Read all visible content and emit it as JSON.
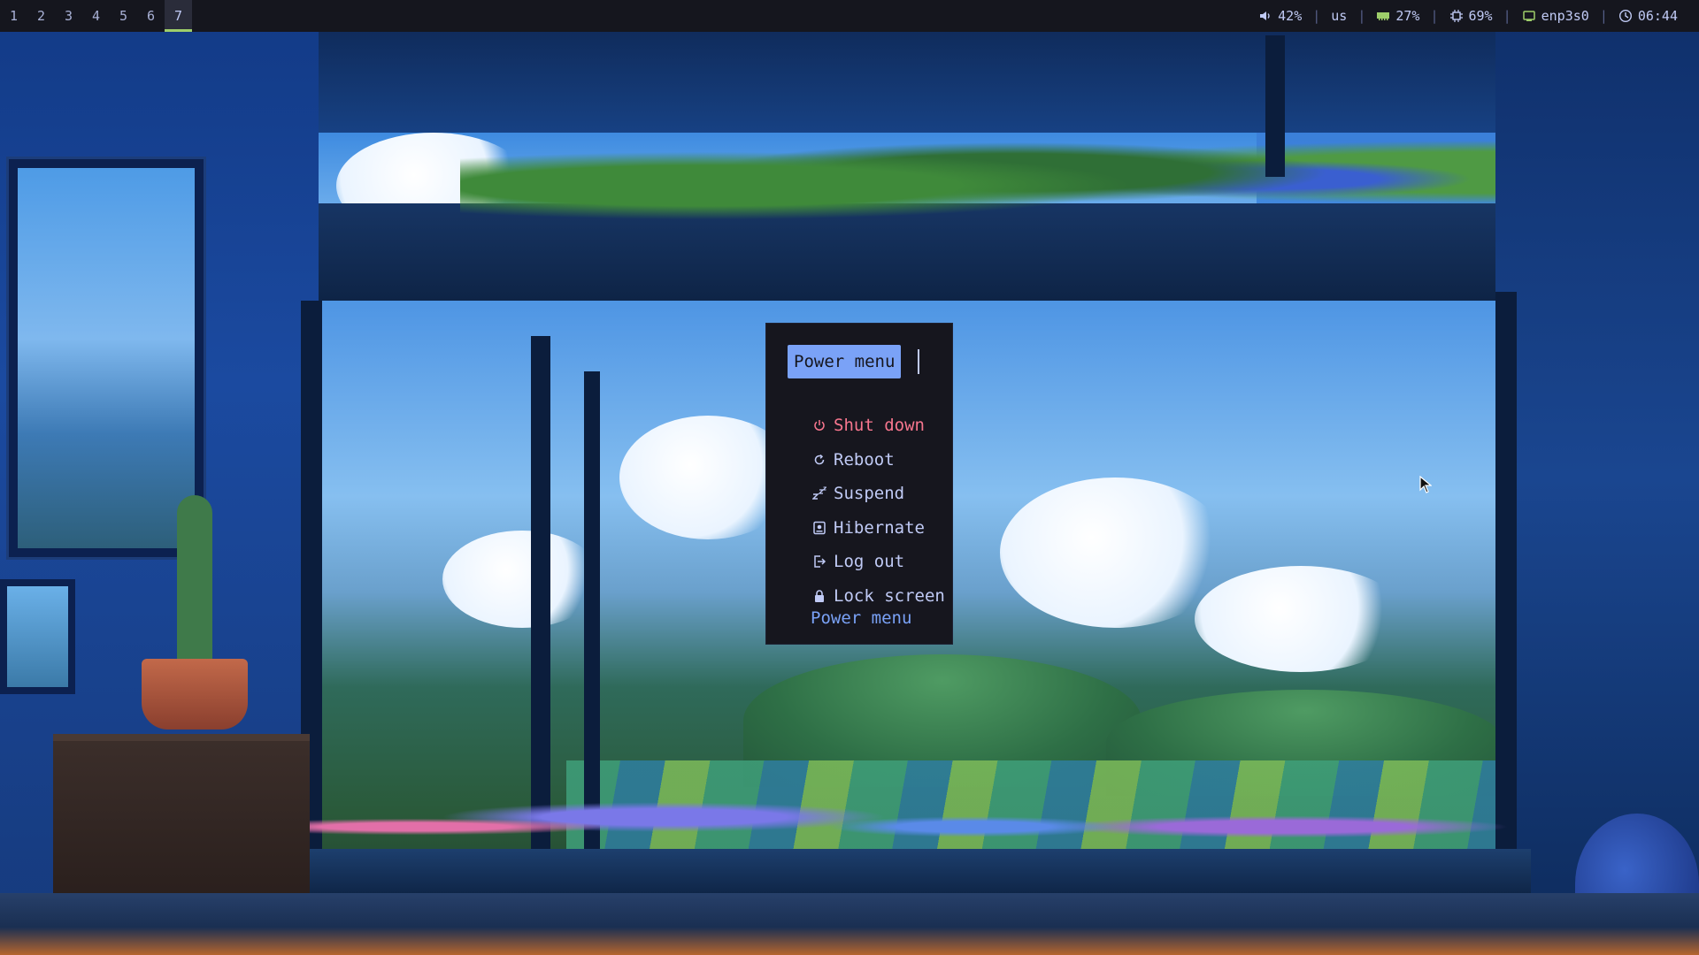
{
  "topbar": {
    "workspaces": [
      "1",
      "2",
      "3",
      "4",
      "5",
      "6",
      "7"
    ],
    "active_workspace": "7",
    "volume": {
      "icon": "volume-icon",
      "label": "42%"
    },
    "keyboard_layout": "us",
    "memory": {
      "icon": "memory-icon",
      "label": "27%"
    },
    "cpu": {
      "icon": "cpu-icon",
      "label": "69%"
    },
    "network": {
      "icon": "network-icon",
      "label": "enp3s0"
    },
    "clock": {
      "icon": "clock-icon",
      "label": "06:44"
    },
    "separator": "|"
  },
  "power_menu": {
    "prompt": "Power menu",
    "items": [
      {
        "icon": "power-icon",
        "label": "Shut down",
        "selected": true
      },
      {
        "icon": "reboot-icon",
        "label": "Reboot",
        "selected": false
      },
      {
        "icon": "sleep-icon",
        "label": "Suspend",
        "selected": false
      },
      {
        "icon": "hibernate-icon",
        "label": "Hibernate",
        "selected": false
      },
      {
        "icon": "logout-icon",
        "label": "Log out",
        "selected": false
      },
      {
        "icon": "lock-icon",
        "label": "Lock screen",
        "selected": false
      }
    ],
    "footer": "Power menu"
  },
  "colors": {
    "bar_bg": "#15161e",
    "accent_blue": "#7aa2f7",
    "selected_pink": "#f7768e",
    "workspace_active": "#9ece6a",
    "text": "#c0caf5"
  }
}
